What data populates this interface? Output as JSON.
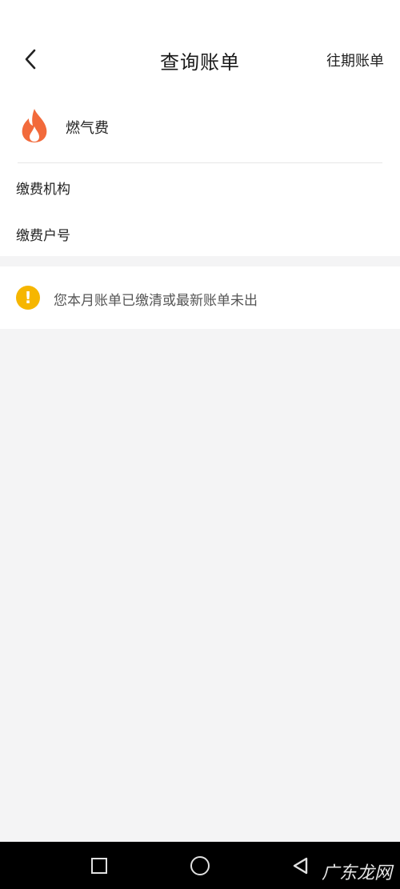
{
  "header": {
    "title": "查询账单",
    "history_label": "往期账单"
  },
  "service": {
    "name": "燃气费",
    "icon": "flame-icon"
  },
  "fields": {
    "org_label": "缴费机构",
    "account_label": "缴费户号"
  },
  "notice": {
    "icon": "warning-icon",
    "text": "您本月账单已缴清或最新账单未出"
  },
  "watermark": {
    "text": "广东龙网"
  },
  "colors": {
    "flame": "#f26a3b",
    "warning": "#f6b600",
    "background": "#f4f4f5"
  }
}
